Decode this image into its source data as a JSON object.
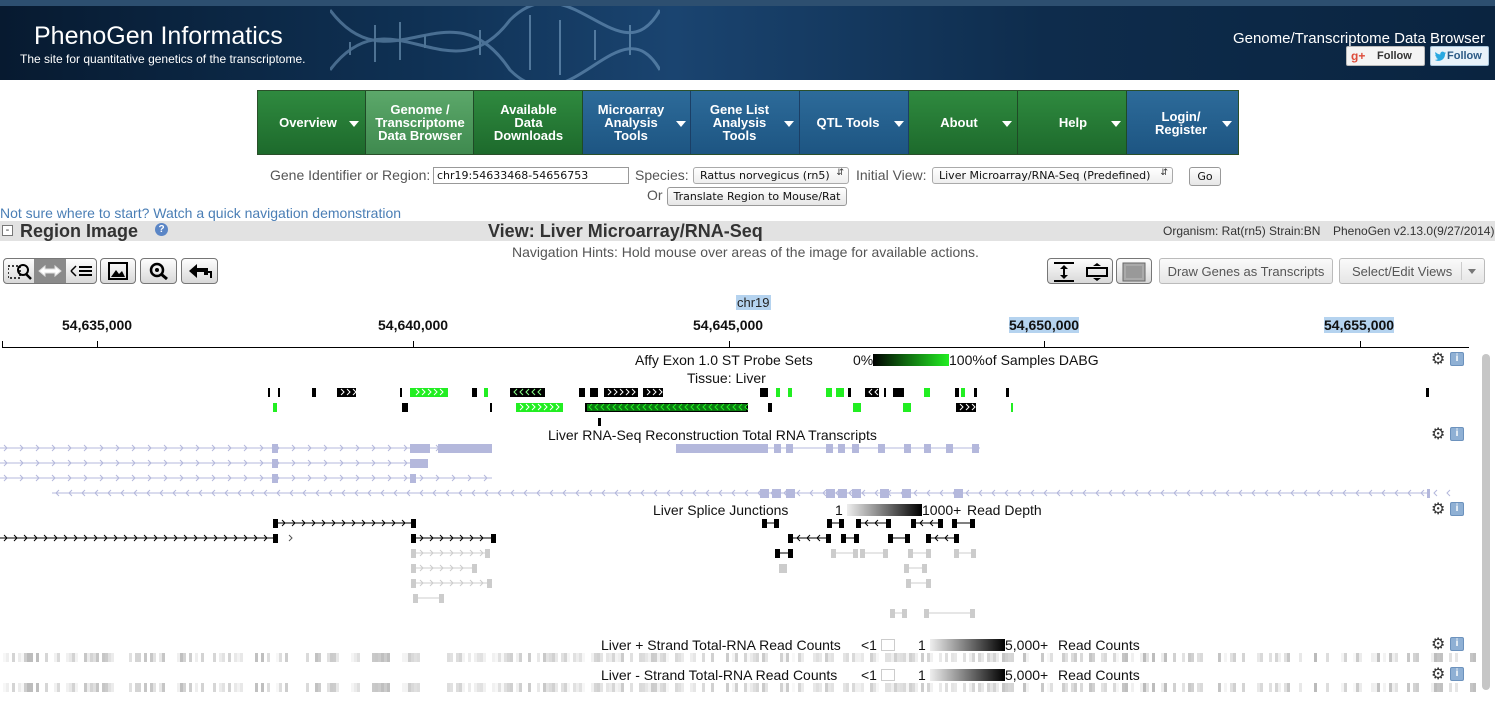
{
  "header": {
    "title": "PhenoGen Informatics",
    "subtitle": "The site for quantitative genetics of the transcriptome.",
    "right_title": "Genome/Transcriptome Data Browser",
    "gplus": {
      "icon": "g+",
      "label": "Follow"
    },
    "twitter": {
      "icon": "twitter-bird-icon",
      "label": "Follow"
    }
  },
  "nav": [
    {
      "label": "Overview",
      "dropdown": true
    },
    {
      "label": "Genome / Transcriptome Data Browser",
      "dropdown": false,
      "active": true
    },
    {
      "label": "Available Data Downloads",
      "dropdown": false
    },
    {
      "label": "Microarray Analysis Tools",
      "dropdown": true
    },
    {
      "label": "Gene List Analysis Tools",
      "dropdown": true
    },
    {
      "label": "QTL Tools",
      "dropdown": true
    },
    {
      "label": "About",
      "dropdown": true
    },
    {
      "label": "Help",
      "dropdown": true
    },
    {
      "label": "Login/ Register",
      "dropdown": true
    }
  ],
  "search": {
    "gene_label": "Gene Identifier or Region:",
    "gene_value": "chr19:54633468-54656753",
    "species_label": "Species:",
    "species_value": "Rattus norvegicus (rn5)",
    "initial_view_label": "Initial View:",
    "initial_view_value": "Liver Microarray/RNA-Seq (Predefined)",
    "go_label": "Go",
    "or_label": "Or",
    "translate_label": "Translate Region to Mouse/Rat"
  },
  "demo_link": "Not sure where to start? Watch a quick navigation demonstration",
  "region": {
    "collapse": "-",
    "title": "Region Image",
    "view_title": "View: Liver Microarray/RNA-Seq",
    "organism": "Organism: Rat(rn5) Strain:BN",
    "version": "PhenoGen v2.13.0(9/27/2014)",
    "hints": "Navigation Hints: Hold mouse over areas of the image for available actions."
  },
  "toolbar": {
    "draw_genes": "Draw Genes as Transcripts",
    "select_views": "Select/Edit Views"
  },
  "browser": {
    "chromosome": "chr19",
    "positions": [
      "54,635,000",
      "54,640,000",
      "54,645,000",
      "54,650,000",
      "54,655,000"
    ],
    "tracks": {
      "probe": {
        "title": "Affy Exon 1.0 ST Probe Sets",
        "legend_min": "0%",
        "legend_max": "100%",
        "legend_suffix": "of Samples DABG",
        "tissue": "Tissue: Liver",
        "colors": {
          "low": "#000000",
          "high": "#22ee22"
        }
      },
      "rnaseq": {
        "title": "Liver RNA-Seq Reconstruction Total RNA Transcripts",
        "color": "#b4b8dc"
      },
      "splice": {
        "title": "Liver Splice Junctions",
        "legend_min": "1",
        "legend_max": "1000+",
        "legend_suffix": "Read Depth"
      },
      "plus": {
        "title": "Liver + Strand Total-RNA Read Counts",
        "lt1": "<1",
        "one": "1",
        "max": "5,000+",
        "suffix": "Read Counts"
      },
      "minus": {
        "title": "Liver - Strand Total-RNA Read Counts",
        "lt1": "<1",
        "one": "1",
        "max": "5,000+",
        "suffix": "Read Counts"
      }
    },
    "track_icons": {
      "settings": "gear-icon",
      "info": "info-icon"
    },
    "info_glyph": "i"
  }
}
